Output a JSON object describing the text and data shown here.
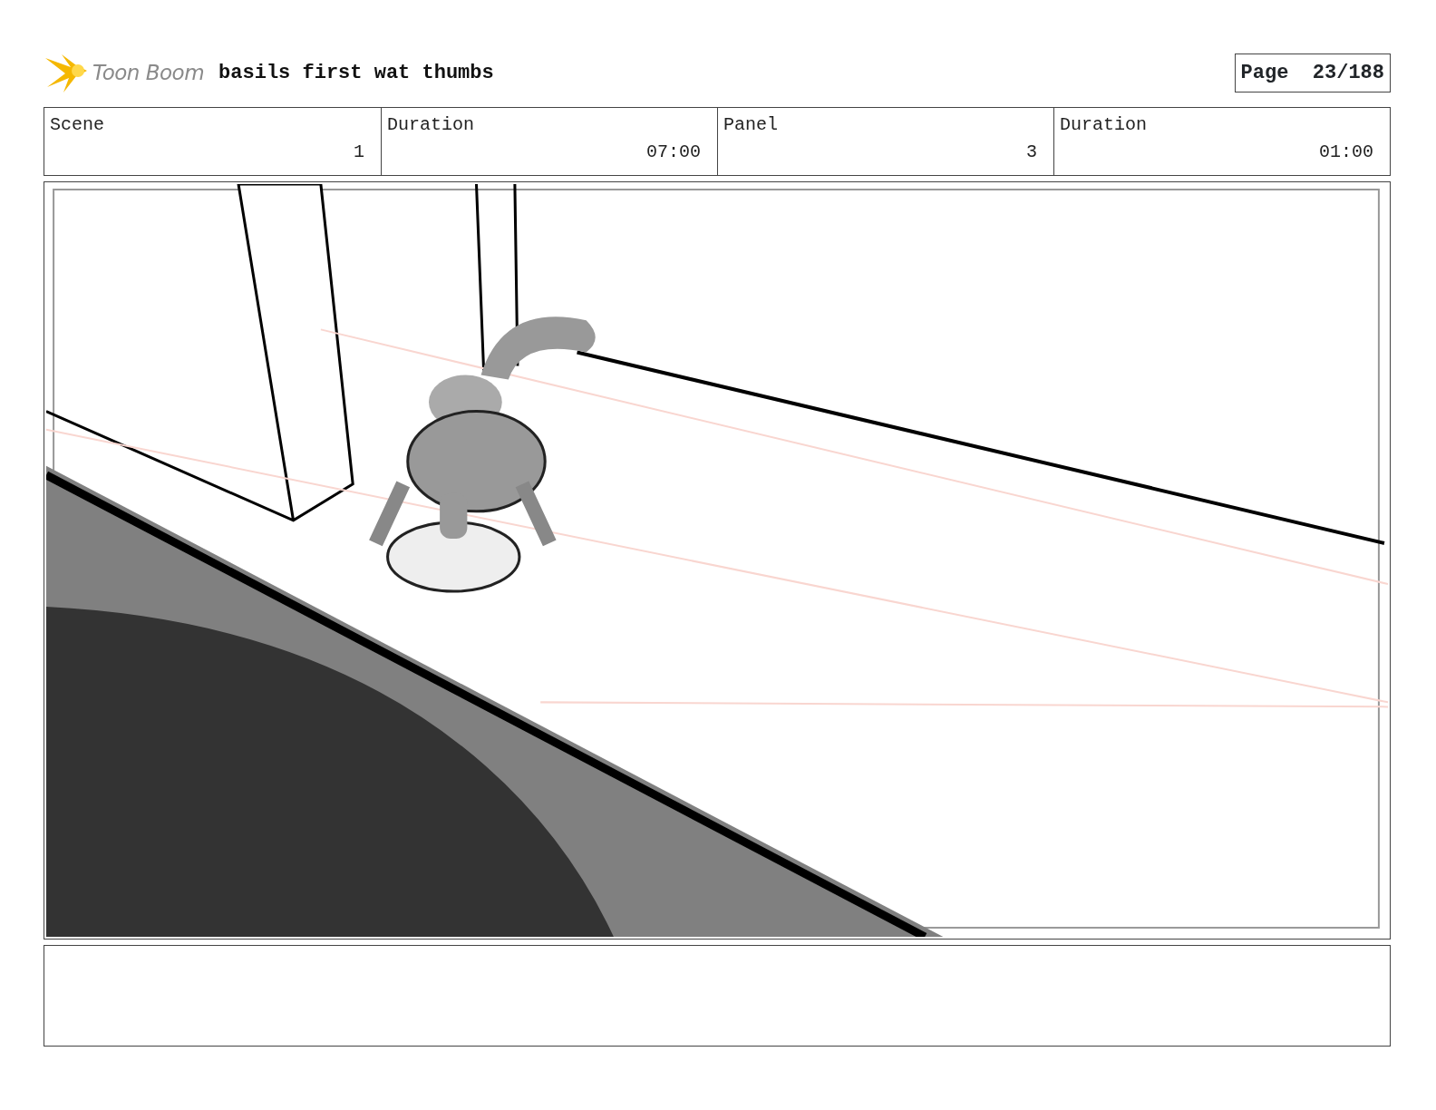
{
  "header": {
    "logo": "Toon Boom",
    "title": "basils first wat thumbs",
    "page": "Page  23/188"
  },
  "fields": [
    {
      "label": "Scene",
      "value": "1"
    },
    {
      "label": "Duration",
      "value": "07:00"
    },
    {
      "label": "Panel",
      "value": "3"
    },
    {
      "label": "Duration",
      "value": "01:00"
    }
  ]
}
